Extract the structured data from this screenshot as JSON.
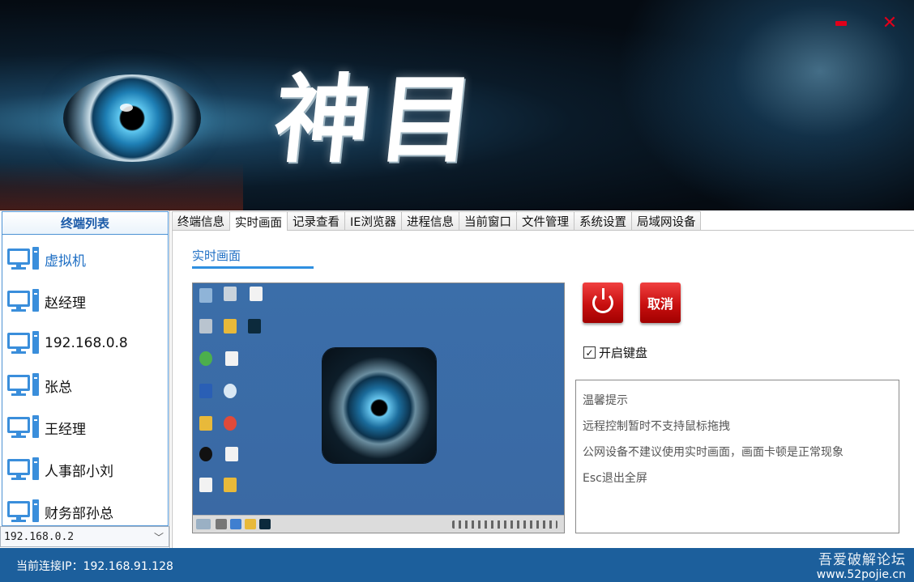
{
  "banner": {
    "title": "神目",
    "minimize_icon": "minimize-icon",
    "close_icon": "close-icon"
  },
  "sidebar": {
    "header": "终端列表",
    "items": [
      {
        "label": "虚拟机",
        "selected": true
      },
      {
        "label": "赵经理",
        "selected": false
      },
      {
        "label": "192.168.0.8",
        "selected": false
      },
      {
        "label": "张总",
        "selected": false
      },
      {
        "label": "王经理",
        "selected": false
      },
      {
        "label": "人事部小刘",
        "selected": false
      },
      {
        "label": "财务部孙总",
        "selected": false
      }
    ],
    "ip_select": "192.168.0.2"
  },
  "tabs": [
    {
      "label": "终端信息",
      "active": false
    },
    {
      "label": "实时画面",
      "active": true
    },
    {
      "label": "记录查看",
      "active": false
    },
    {
      "label": "IE浏览器",
      "active": false
    },
    {
      "label": "进程信息",
      "active": false
    },
    {
      "label": "当前窗口",
      "active": false
    },
    {
      "label": "文件管理",
      "active": false
    },
    {
      "label": "系统设置",
      "active": false
    },
    {
      "label": "局域网设备",
      "active": false
    }
  ],
  "main": {
    "section_title": "实时画面",
    "cancel_label": "取消",
    "keyboard_label": "开启键盘",
    "keyboard_checked": true,
    "tips": [
      "温馨提示",
      "远程控制暂时不支持鼠标拖拽",
      "公网设备不建议使用实时画面，画面卡顿是正常现象",
      "Esc退出全屏"
    ]
  },
  "status": {
    "connection": "当前连接IP：192.168.91.128",
    "watermark_line1": "吾爱破解论坛",
    "watermark_line2": "www.52pojie.cn"
  },
  "colors": {
    "accent": "#1f6fc4",
    "status_bar": "#1c5f9c",
    "danger": "#e0001a"
  }
}
